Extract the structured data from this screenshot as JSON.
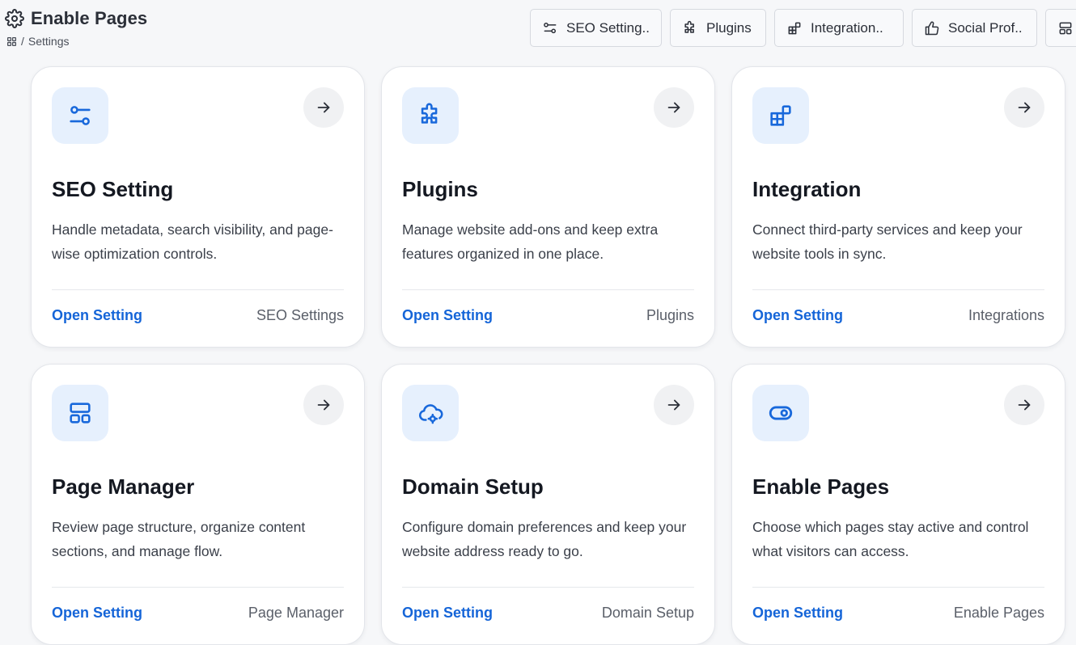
{
  "header": {
    "title": "Enable Pages",
    "breadcrumb": {
      "separator": "/",
      "current": "Settings"
    }
  },
  "toolbar": [
    {
      "label": "SEO Setting..",
      "icon": "sliders-icon"
    },
    {
      "label": "Plugins",
      "icon": "puzzle-icon"
    },
    {
      "label": "Integration..",
      "icon": "blocks-icon"
    },
    {
      "label": "Social Prof..",
      "icon": "thumbs-up-icon"
    },
    {
      "label": "",
      "icon": "layout-icon"
    }
  ],
  "cards": [
    {
      "title": "SEO Setting",
      "description": "Handle metadata, search visibility, and page-wise optimization controls.",
      "link": "Open Setting",
      "meta": "SEO Settings",
      "icon": "sliders-icon"
    },
    {
      "title": "Plugins",
      "description": "Manage website add-ons and keep extra features organized in one place.",
      "link": "Open Setting",
      "meta": "Plugins",
      "icon": "puzzle-icon"
    },
    {
      "title": "Integration",
      "description": "Connect third-party services and keep your website tools in sync.",
      "link": "Open Setting",
      "meta": "Integrations",
      "icon": "blocks-icon"
    },
    {
      "title": "Page Manager",
      "description": "Review page structure, organize content sections, and manage flow.",
      "link": "Open Setting",
      "meta": "Page Manager",
      "icon": "layout-icon"
    },
    {
      "title": "Domain Setup",
      "description": "Configure domain preferences and keep your website address ready to go.",
      "link": "Open Setting",
      "meta": "Domain Setup",
      "icon": "cloud-cog-icon"
    },
    {
      "title": "Enable Pages",
      "description": "Choose which pages stay active and control what visitors can access.",
      "link": "Open Setting",
      "meta": "Enable Pages",
      "icon": "toggle-icon"
    }
  ],
  "colors": {
    "accent": "#1565d8",
    "icon_bg": "#e6f0fd",
    "page_bg": "#f6f7f9"
  }
}
